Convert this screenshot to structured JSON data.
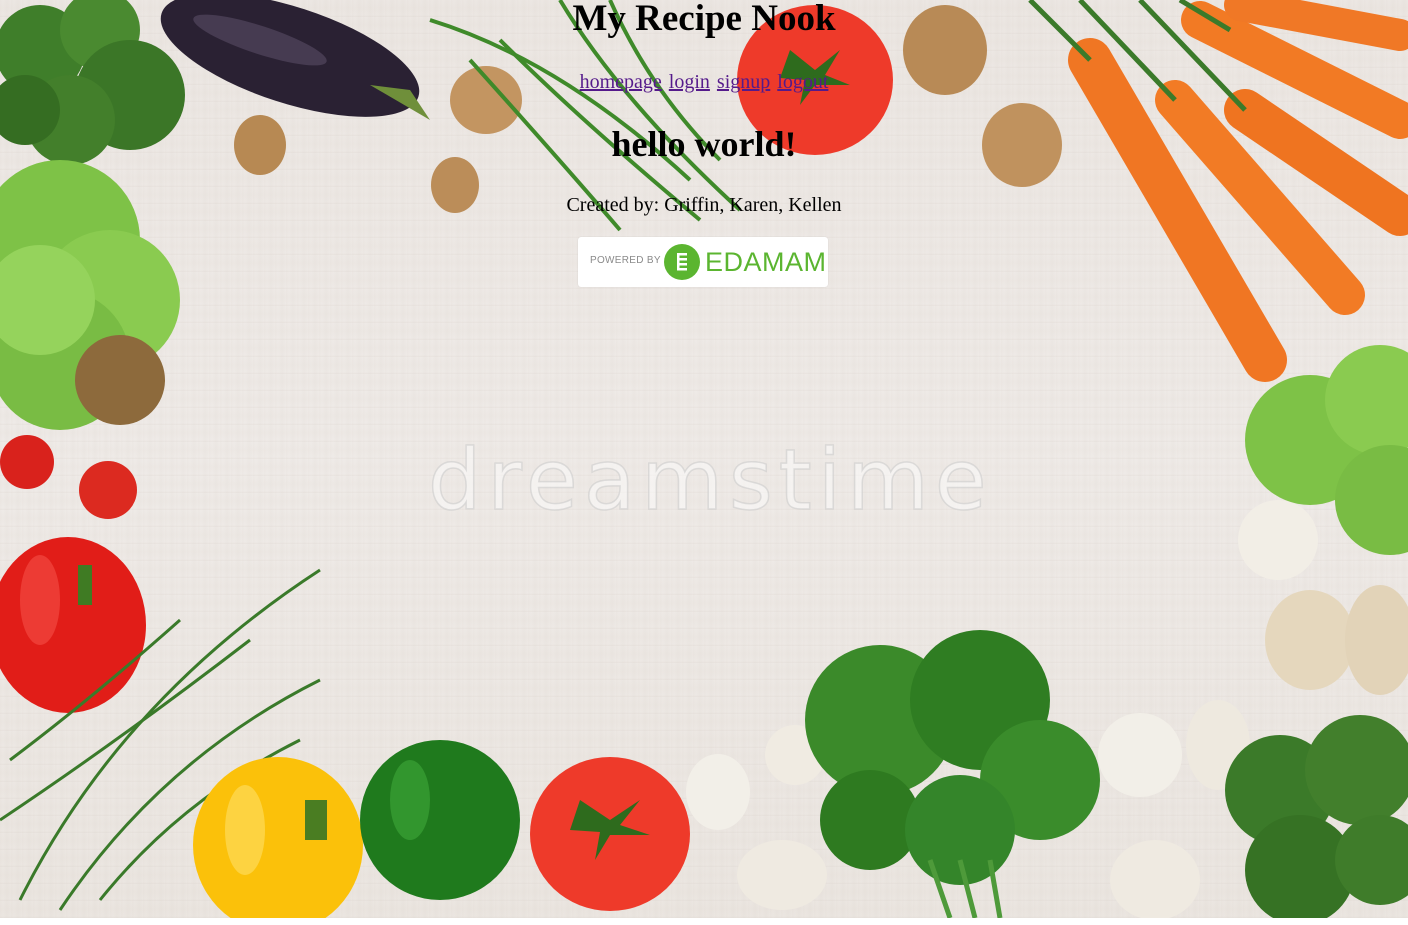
{
  "header": {
    "title": "My Recipe Nook"
  },
  "nav": {
    "links": [
      "homepage",
      "login",
      "signup",
      "logout"
    ]
  },
  "main": {
    "greeting": "hello world!",
    "credits": "Created by: Griffin, Karen, Kellen"
  },
  "badge": {
    "powered_by": "POWERED BY",
    "brand": "EDAMAM",
    "brand_color": "#5bb530"
  },
  "background": {
    "watermark": "dreamstime"
  }
}
